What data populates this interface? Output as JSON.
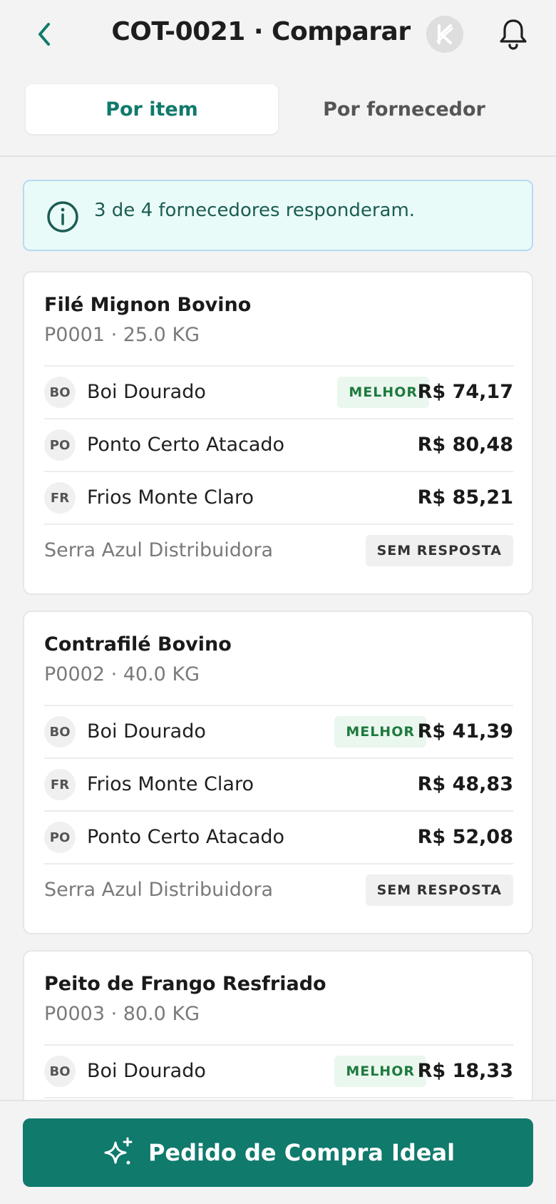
{
  "header": {
    "title": "COT-0021 · Comparar",
    "back_icon": "chevron-left-icon",
    "brand_icon": "brand-logo-icon",
    "bell_icon": "bell-icon"
  },
  "tabs": [
    {
      "label": "Por item",
      "active": true
    },
    {
      "label": "Por fornecedor",
      "active": false
    }
  ],
  "info_banner": {
    "icon": "info-icon",
    "text": "3 de 4 fornecedores responderam."
  },
  "colors": {
    "accent": "#107a6c",
    "best_badge_bg": "#eaf7ee",
    "best_badge_text": "#1e7a3f",
    "banner_bg": "#e9fbf8"
  },
  "items": [
    {
      "name": "Filé Mignon Bovino",
      "subtitle": "P0001 · 25.0 KG",
      "quotes": [
        {
          "initials": "BO",
          "supplier": "Boi Dourado",
          "badge": "MELHOR",
          "price": "R$ 74,17"
        },
        {
          "initials": "PO",
          "supplier": "Ponto Certo Atacado",
          "badge": "",
          "price": "R$ 80,48"
        },
        {
          "initials": "FR",
          "supplier": "Frios Monte Claro",
          "badge": "",
          "price": "R$ 85,21"
        }
      ],
      "no_response": {
        "supplier": "Serra Azul Distribuidora",
        "badge": "SEM RESPOSTA"
      }
    },
    {
      "name": "Contrafilé Bovino",
      "subtitle": "P0002 · 40.0 KG",
      "quotes": [
        {
          "initials": "BO",
          "supplier": "Boi Dourado",
          "badge": "MELHOR",
          "price": "R$ 41,39"
        },
        {
          "initials": "FR",
          "supplier": "Frios Monte Claro",
          "badge": "",
          "price": "R$ 48,83"
        },
        {
          "initials": "PO",
          "supplier": "Ponto Certo Atacado",
          "badge": "",
          "price": "R$ 52,08"
        }
      ],
      "no_response": {
        "supplier": "Serra Azul Distribuidora",
        "badge": "SEM RESPOSTA"
      }
    },
    {
      "name": "Peito de Frango Resfriado",
      "subtitle": "P0003 · 80.0 KG",
      "quotes": [
        {
          "initials": "BO",
          "supplier": "Boi Dourado",
          "badge": "MELHOR",
          "price": "R$ 18,33"
        }
      ]
    }
  ],
  "cta": {
    "label": "Pedido de Compra Ideal",
    "icon": "sparkles-icon"
  }
}
